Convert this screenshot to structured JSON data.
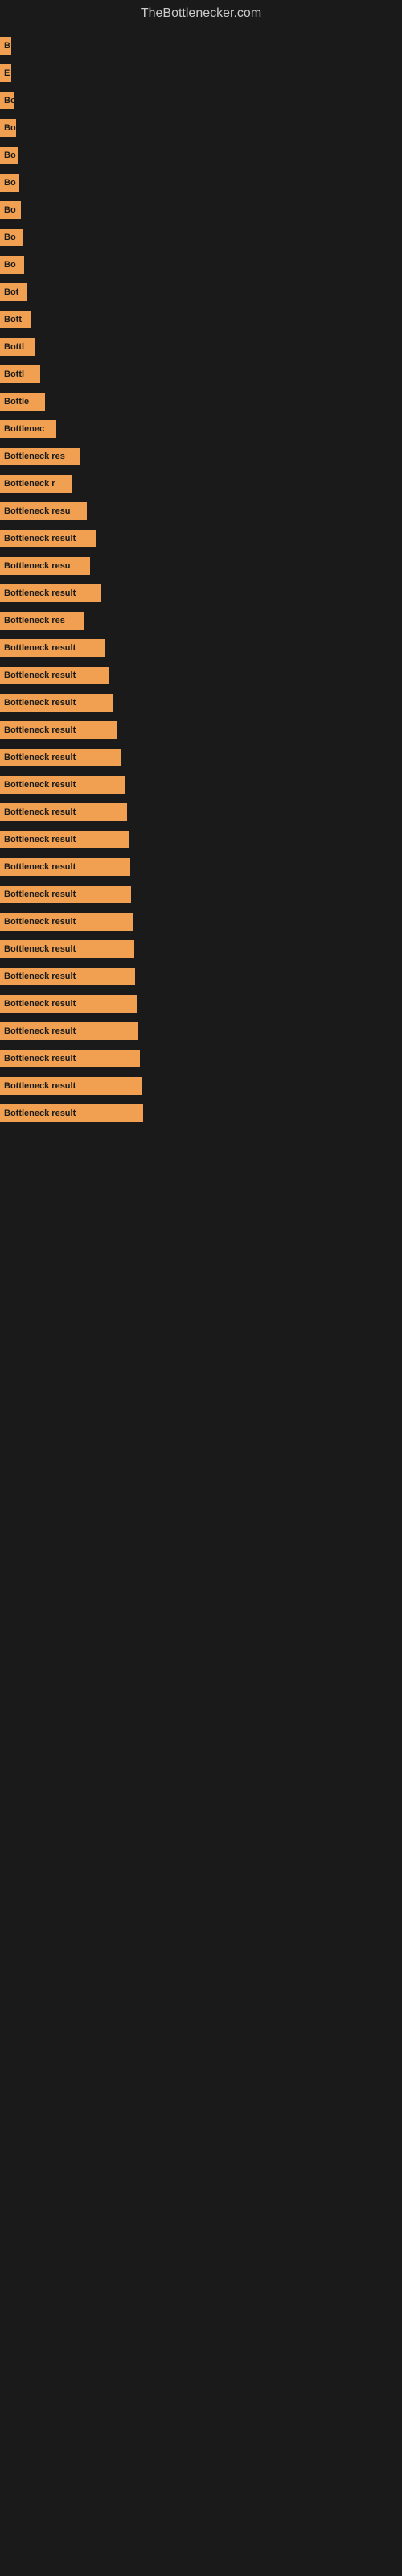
{
  "site": {
    "title": "TheBottlenecker.com"
  },
  "rows": [
    {
      "id": 1,
      "label": "B",
      "width": 14
    },
    {
      "id": 2,
      "label": "E",
      "width": 14
    },
    {
      "id": 3,
      "label": "Bo",
      "width": 18
    },
    {
      "id": 4,
      "label": "Bo",
      "width": 20
    },
    {
      "id": 5,
      "label": "Bo",
      "width": 22
    },
    {
      "id": 6,
      "label": "Bo",
      "width": 24
    },
    {
      "id": 7,
      "label": "Bo",
      "width": 26
    },
    {
      "id": 8,
      "label": "Bo",
      "width": 28
    },
    {
      "id": 9,
      "label": "Bo",
      "width": 30
    },
    {
      "id": 10,
      "label": "Bot",
      "width": 34
    },
    {
      "id": 11,
      "label": "Bott",
      "width": 38
    },
    {
      "id": 12,
      "label": "Bottl",
      "width": 44
    },
    {
      "id": 13,
      "label": "Bottl",
      "width": 50
    },
    {
      "id": 14,
      "label": "Bottle",
      "width": 56
    },
    {
      "id": 15,
      "label": "Bottlenec",
      "width": 70
    },
    {
      "id": 16,
      "label": "Bottleneck res",
      "width": 100
    },
    {
      "id": 17,
      "label": "Bottleneck r",
      "width": 90
    },
    {
      "id": 18,
      "label": "Bottleneck resu",
      "width": 108
    },
    {
      "id": 19,
      "label": "Bottleneck result",
      "width": 120
    },
    {
      "id": 20,
      "label": "Bottleneck resu",
      "width": 112
    },
    {
      "id": 21,
      "label": "Bottleneck result",
      "width": 125
    },
    {
      "id": 22,
      "label": "Bottleneck res",
      "width": 105
    },
    {
      "id": 23,
      "label": "Bottleneck result",
      "width": 130
    },
    {
      "id": 24,
      "label": "Bottleneck result",
      "width": 135
    },
    {
      "id": 25,
      "label": "Bottleneck result",
      "width": 140
    },
    {
      "id": 26,
      "label": "Bottleneck result",
      "width": 145
    },
    {
      "id": 27,
      "label": "Bottleneck result",
      "width": 150
    },
    {
      "id": 28,
      "label": "Bottleneck result",
      "width": 155
    },
    {
      "id": 29,
      "label": "Bottleneck result",
      "width": 158
    },
    {
      "id": 30,
      "label": "Bottleneck result",
      "width": 160
    },
    {
      "id": 31,
      "label": "Bottleneck result",
      "width": 162
    },
    {
      "id": 32,
      "label": "Bottleneck result",
      "width": 163
    },
    {
      "id": 33,
      "label": "Bottleneck result",
      "width": 165
    },
    {
      "id": 34,
      "label": "Bottleneck result",
      "width": 167
    },
    {
      "id": 35,
      "label": "Bottleneck result",
      "width": 168
    },
    {
      "id": 36,
      "label": "Bottleneck result",
      "width": 170
    },
    {
      "id": 37,
      "label": "Bottleneck result",
      "width": 172
    },
    {
      "id": 38,
      "label": "Bottleneck result",
      "width": 174
    },
    {
      "id": 39,
      "label": "Bottleneck result",
      "width": 176
    },
    {
      "id": 40,
      "label": "Bottleneck result",
      "width": 178
    }
  ]
}
